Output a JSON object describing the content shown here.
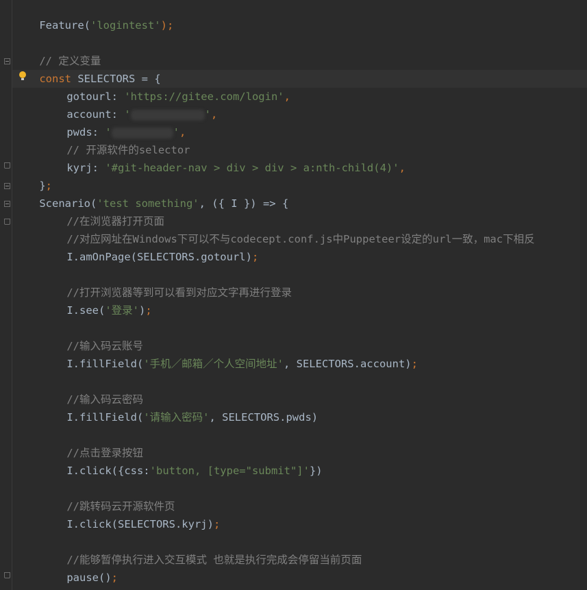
{
  "editor": {
    "lines": {
      "l1": {
        "a": "Feature(",
        "b": "'logintest'",
        "c": ");"
      },
      "l3": {
        "a": "// 定义变量"
      },
      "l4": {
        "a": "const",
        "b": " SELECTORS = {"
      },
      "l5": {
        "a": "gotourl: ",
        "b": "'https://gitee.com/login'",
        "c": ","
      },
      "l6": {
        "a": "account: ",
        "b": "'",
        "c": "'",
        "d": ","
      },
      "l7": {
        "a": "pwds: ",
        "b": "'",
        "c": "'",
        "d": ","
      },
      "l8": {
        "a": "// 开源软件的selector"
      },
      "l9": {
        "a": "kyrj: ",
        "b": "'#git-header-nav > div > div > a:nth-child(4)'",
        "c": ","
      },
      "l10": {
        "a": "}",
        "b": ";"
      },
      "l11": {
        "a": "Scenario(",
        "b": "'test something'",
        "c": ", ({ I }) => {"
      },
      "l12": {
        "a": "//在浏览器打开页面"
      },
      "l13": {
        "a": "//对应网址在Windows下可以不与codecept.conf.js中Puppeteer设定的url一致，mac下相反"
      },
      "l14": {
        "a": "I.amOnPage(SELECTORS.gotourl)",
        "b": ";"
      },
      "l16": {
        "a": "//打开浏览器等到可以看到对应文字再进行登录"
      },
      "l17": {
        "a": "I.see(",
        "b": "'登录'",
        "c": ")",
        "d": ";"
      },
      "l19": {
        "a": "//输入码云账号"
      },
      "l20": {
        "a": "I.fillField(",
        "b": "'手机／邮箱／个人空间地址'",
        "c": ", SELECTORS.account)",
        "d": ";"
      },
      "l22": {
        "a": "//输入码云密码"
      },
      "l23": {
        "a": "I.fillField(",
        "b": "'请输入密码'",
        "c": ", SELECTORS.pwds)"
      },
      "l25": {
        "a": "//点击登录按钮"
      },
      "l26": {
        "a": "I.click({css:",
        "b": "'button, [type=\"submit\"]'",
        "c": "})"
      },
      "l28": {
        "a": "//跳转码云开源软件页"
      },
      "l29": {
        "a": "I.click(SELECTORS.kyrj)",
        "b": ";"
      },
      "l31": {
        "a": "//能够暂停执行进入交互模式 也就是执行完成会停留当前页面"
      },
      "l32": {
        "a": "pause()",
        "b": ";"
      },
      "l33": {
        "a": "})",
        "b": ";"
      }
    },
    "colors": {
      "background": "#2b2b2b",
      "keyword": "#cc7832",
      "string": "#6a8759",
      "comment": "#808080",
      "text": "#a9b7c6"
    },
    "gutter_icons": [
      "fold-icon",
      "lightbulb-icon"
    ]
  }
}
